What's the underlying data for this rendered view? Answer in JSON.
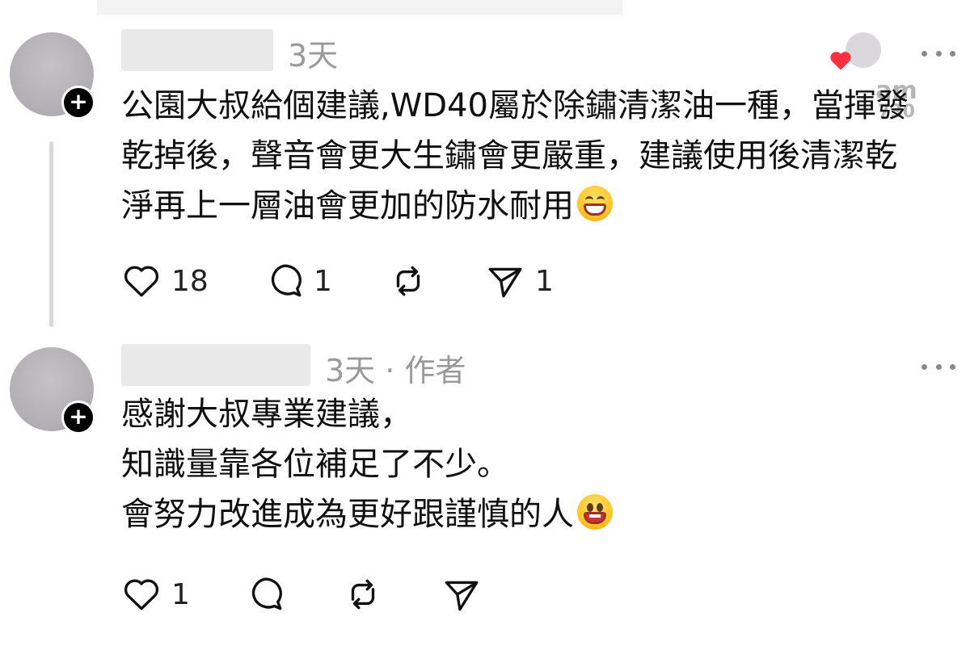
{
  "posts": [
    {
      "time": "3天",
      "lines": [
        "公園大叔給個建議,WD40屬於除鏽清潔油一種，當揮發",
        "乾掉後，聲音會更大生鏽會更嚴重，建議使用後清潔乾",
        "淨再上一層油會更加的防水耐用"
      ],
      "emoji": "grinning-face-with-smiling-eyes",
      "likes": "18",
      "comments": "1",
      "reposts": "",
      "shares": "1"
    },
    {
      "time": "3天 · 作者",
      "lines": [
        "感謝大叔專業建議，",
        "知識量靠各位補足了不少。",
        "會努力改進成為更好跟謹慎的人"
      ],
      "emoji": "grinning-face-with-big-eyes",
      "likes": "1",
      "comments": "",
      "reposts": "",
      "shares": ""
    }
  ],
  "watermark": {
    "line1": "am",
    "line2": "730"
  },
  "colors": {
    "heart": "#ff3040",
    "meta": "#9a9a9a",
    "thread_line": "#d9d9d9"
  }
}
